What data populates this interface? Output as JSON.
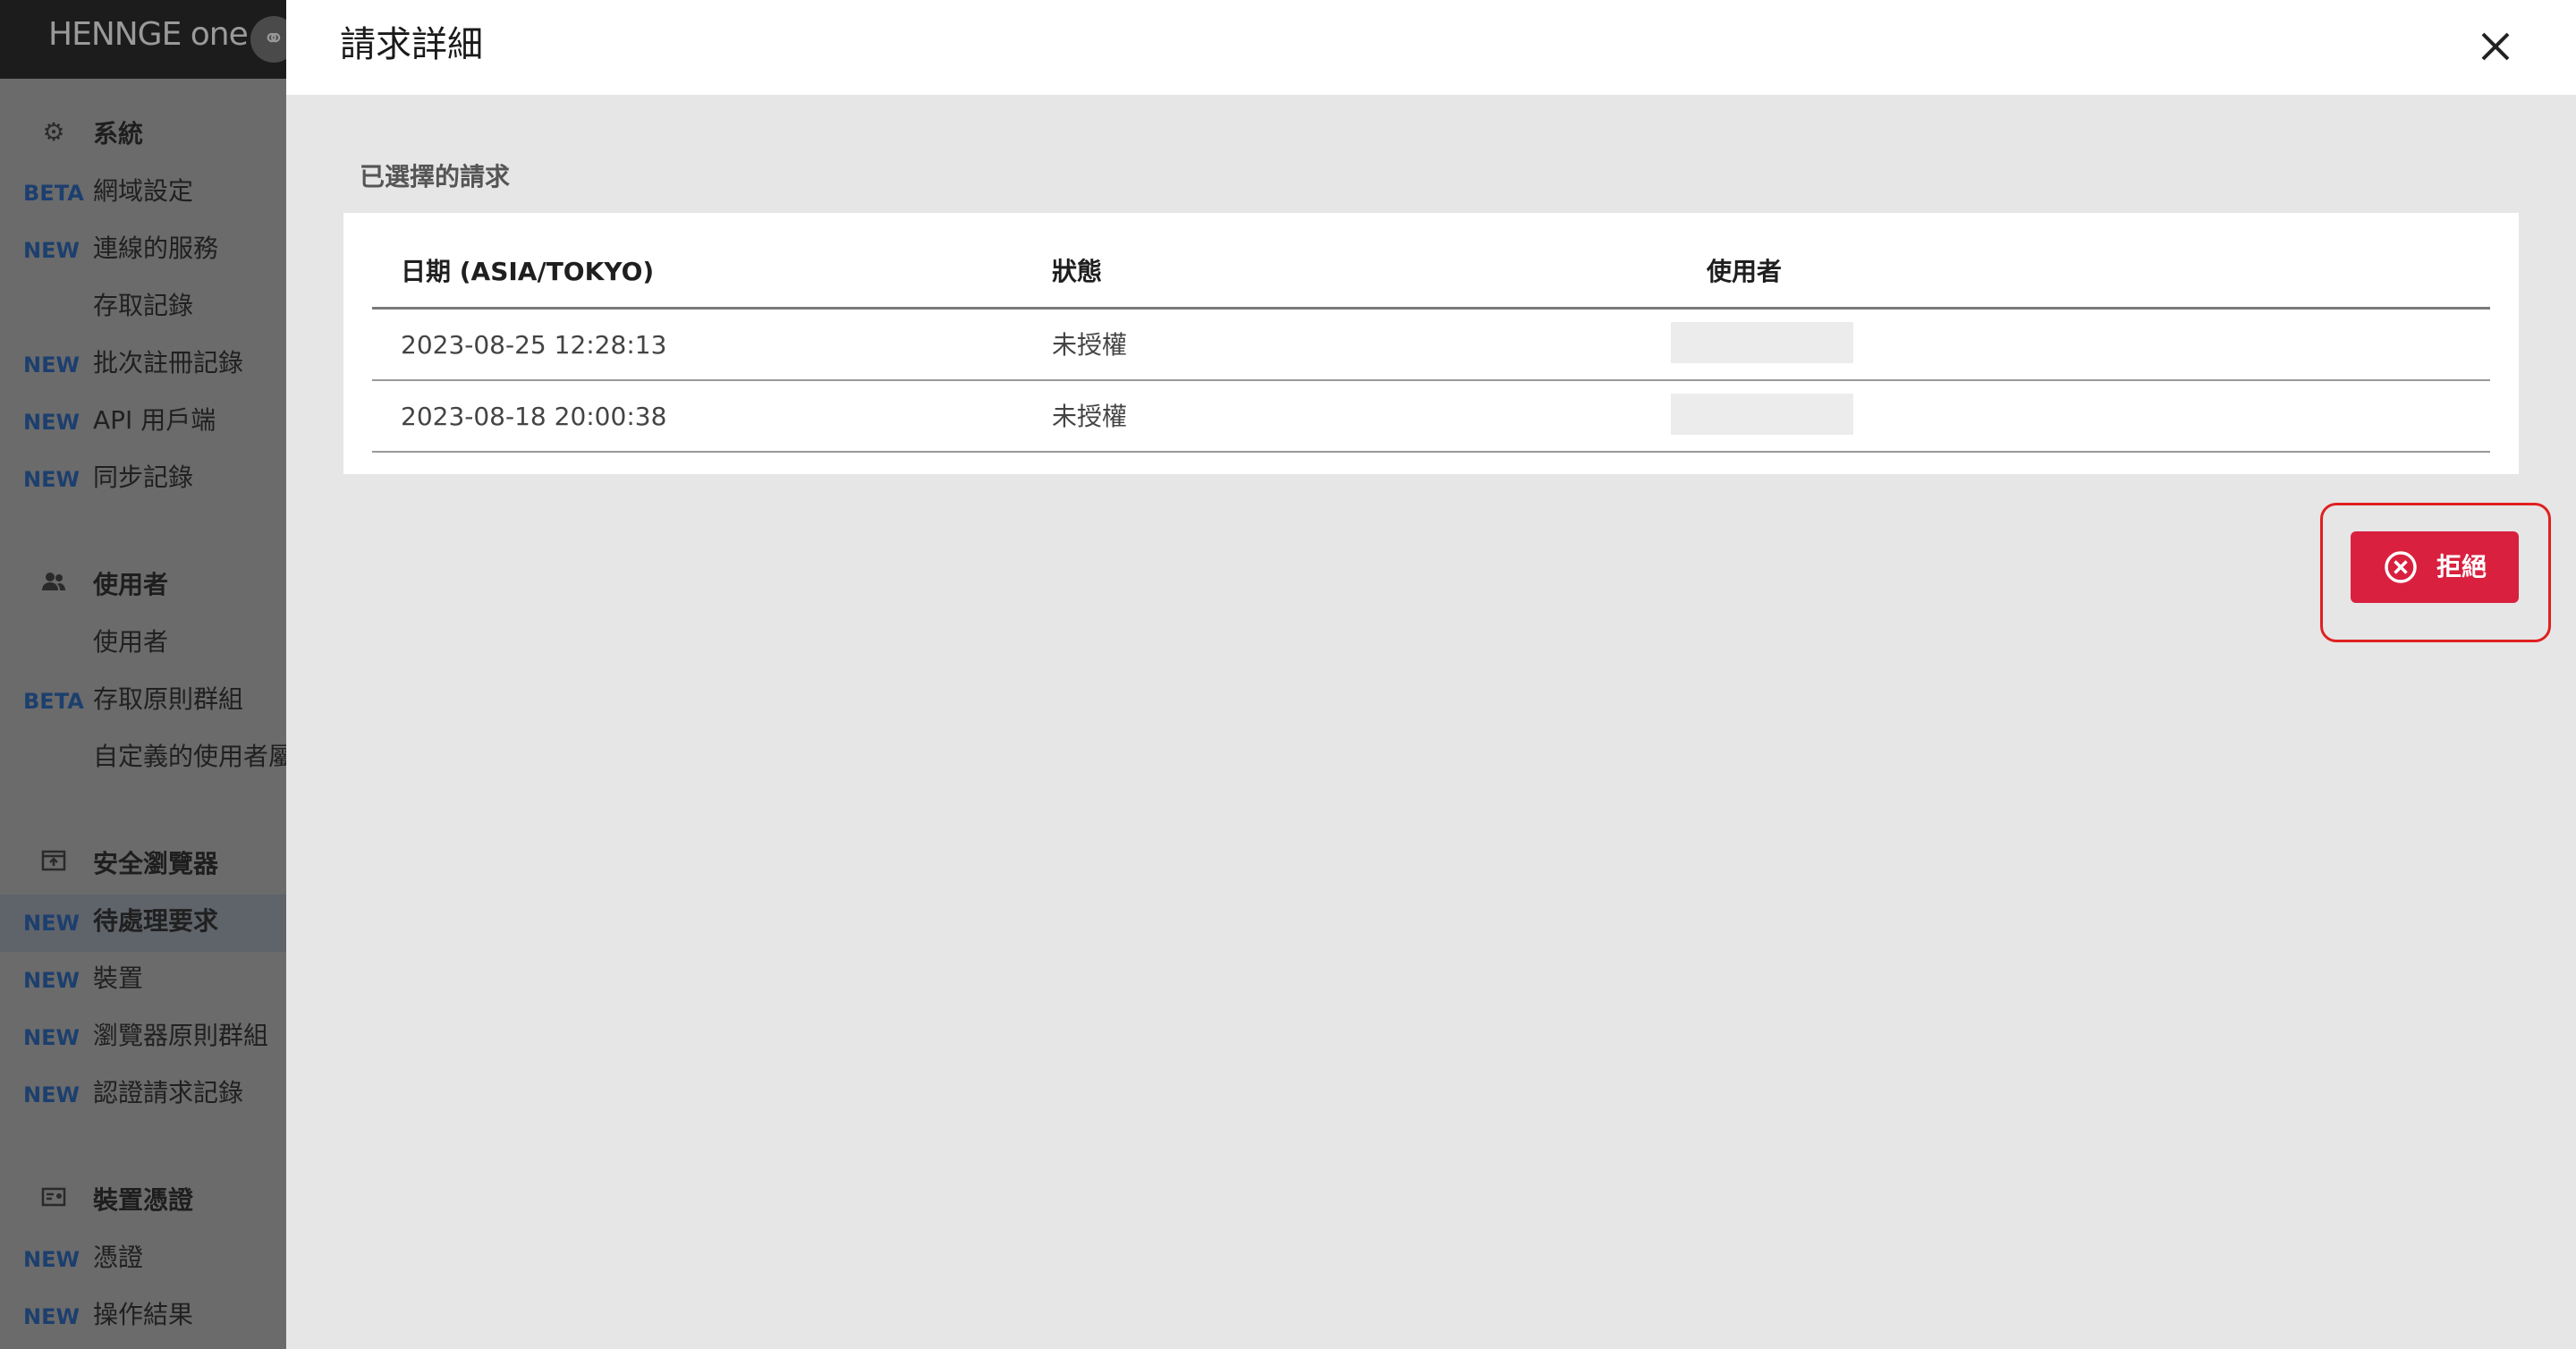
{
  "app": {
    "logo_text": "HENNGE one"
  },
  "sidebar": {
    "sections": [
      {
        "icon": "gear-icon",
        "label": "系統"
      },
      {
        "icon": "users-icon",
        "label": "使用者"
      },
      {
        "icon": "browser-icon",
        "label": "安全瀏覽器"
      },
      {
        "icon": "certificate-icon",
        "label": "裝置憑證"
      }
    ],
    "items": [
      {
        "tag": "BETA",
        "label": "網域設定"
      },
      {
        "tag": "NEW",
        "label": "連線的服務"
      },
      {
        "tag": "",
        "label": "存取記錄"
      },
      {
        "tag": "NEW",
        "label": "批次註冊記錄"
      },
      {
        "tag": "NEW",
        "label": "API 用戶端"
      },
      {
        "tag": "NEW",
        "label": "同步記錄"
      },
      {
        "tag": "",
        "label": "使用者"
      },
      {
        "tag": "BETA",
        "label": "存取原則群組"
      },
      {
        "tag": "",
        "label": "自定義的使用者屬"
      },
      {
        "tag": "NEW",
        "label": "待處理要求"
      },
      {
        "tag": "NEW",
        "label": "裝置"
      },
      {
        "tag": "NEW",
        "label": "瀏覽器原則群組"
      },
      {
        "tag": "NEW",
        "label": "認證請求記錄"
      },
      {
        "tag": "NEW",
        "label": "憑證"
      },
      {
        "tag": "NEW",
        "label": "操作結果"
      }
    ]
  },
  "modal": {
    "title": "請求詳細",
    "section_label": "已選擇的請求",
    "table": {
      "headers": [
        "日期 (ASIA/TOKYO)",
        "狀態",
        "使用者"
      ],
      "rows": [
        {
          "date": "2023-08-25 12:28:13",
          "status": "未授權"
        },
        {
          "date": "2023-08-18 20:00:38",
          "status": "未授權"
        }
      ]
    },
    "reject_label": "拒絕"
  },
  "colors": {
    "reject": "#d9203f",
    "highlight": "#e02020",
    "tag": "#1c3f6e"
  }
}
